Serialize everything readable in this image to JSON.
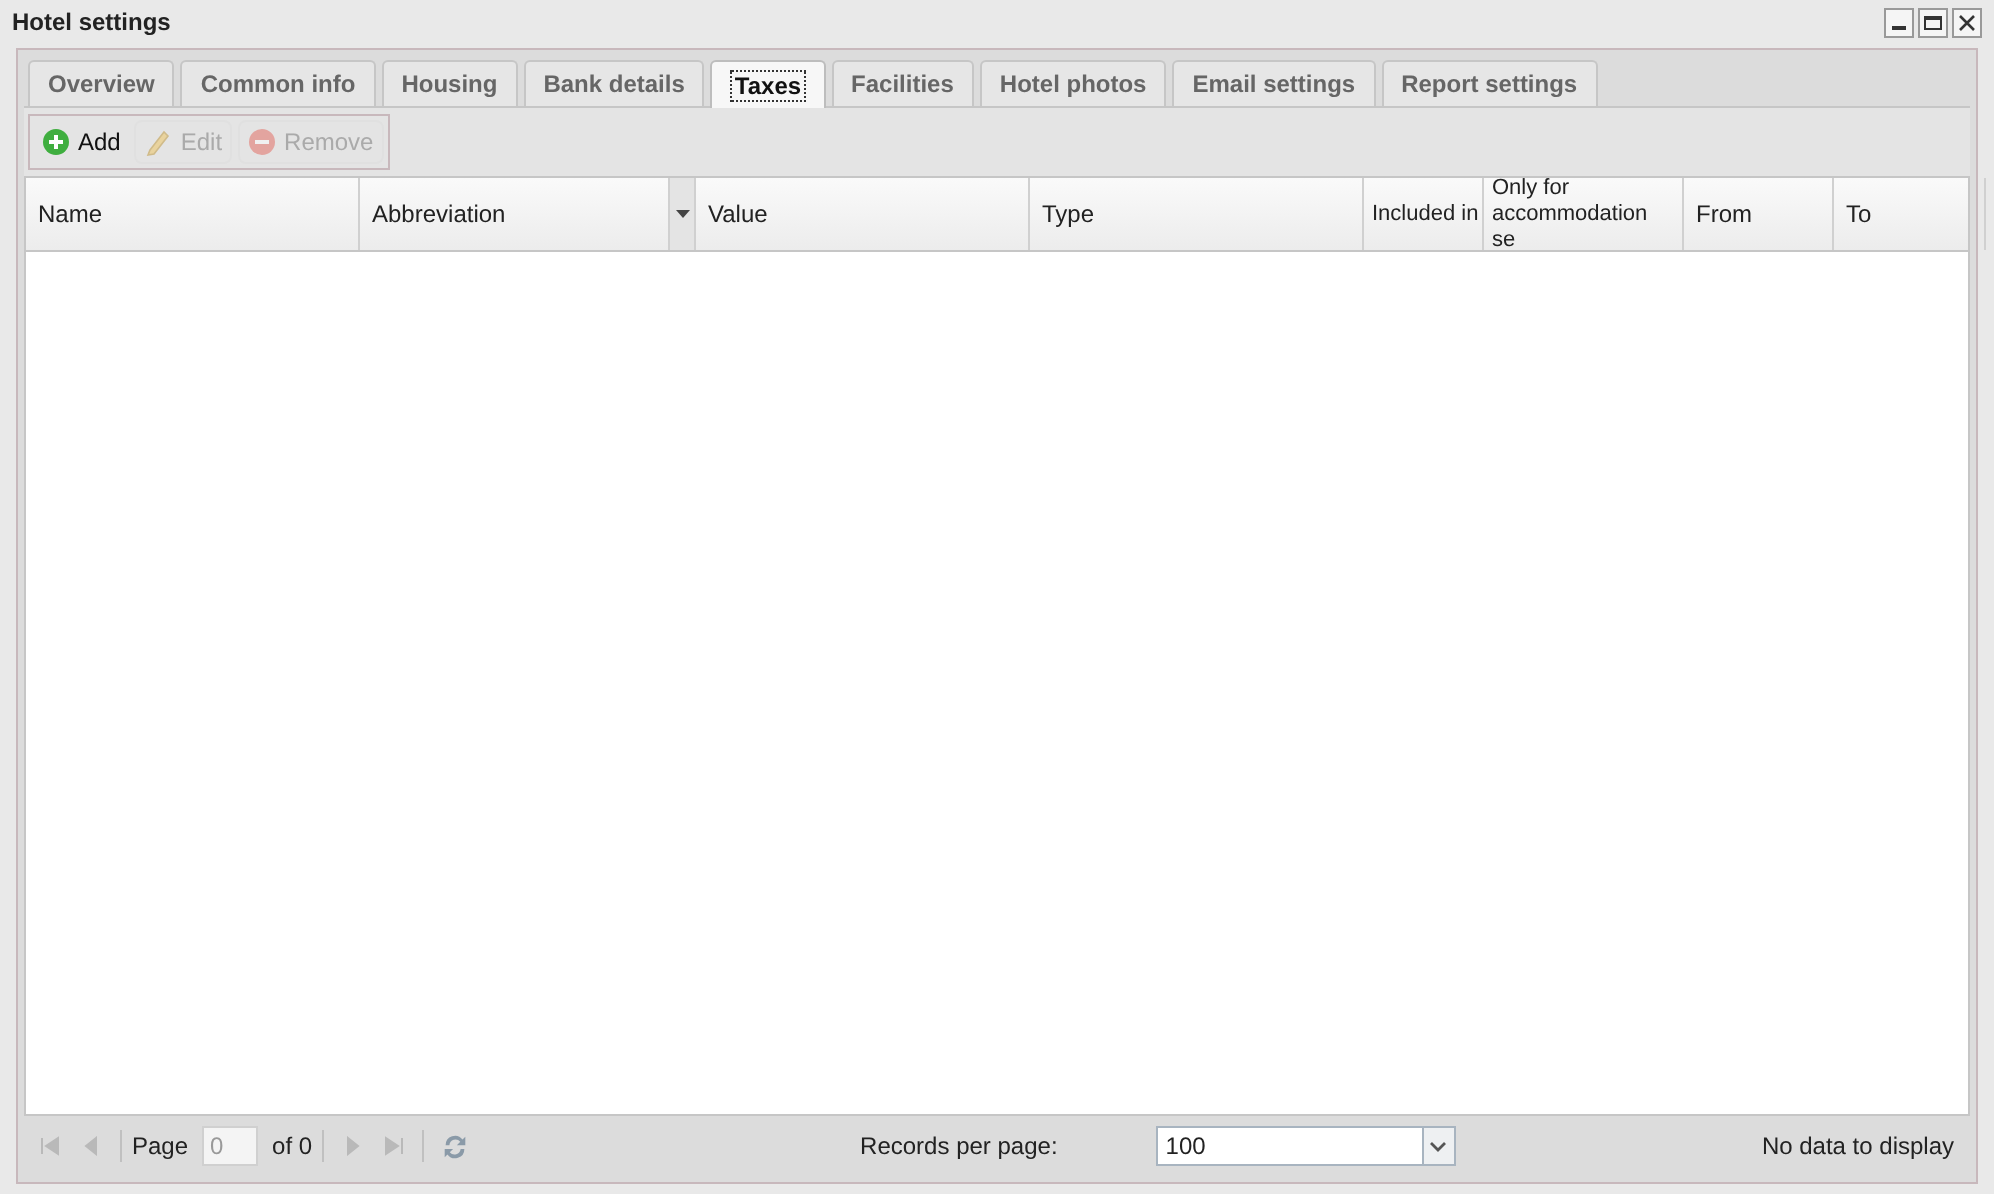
{
  "window": {
    "title": "Hotel settings"
  },
  "tabs": [
    {
      "label": "Overview",
      "selected": false
    },
    {
      "label": "Common info",
      "selected": false
    },
    {
      "label": "Housing",
      "selected": false
    },
    {
      "label": "Bank details",
      "selected": false
    },
    {
      "label": "Taxes",
      "selected": true
    },
    {
      "label": "Facilities",
      "selected": false
    },
    {
      "label": "Hotel photos",
      "selected": false
    },
    {
      "label": "Email settings",
      "selected": false
    },
    {
      "label": "Report settings",
      "selected": false
    }
  ],
  "toolbar": [
    {
      "kind": "add",
      "label": "Add",
      "disabled": false
    },
    {
      "kind": "edit",
      "label": "Edit",
      "disabled": true
    },
    {
      "kind": "remove",
      "label": "Remove",
      "disabled": true
    }
  ],
  "table": {
    "columns": [
      {
        "label": "Name",
        "menu": false
      },
      {
        "label": "Abbreviation",
        "menu": true
      },
      {
        "label": "Value",
        "menu": false
      },
      {
        "label": "Type",
        "menu": false
      },
      {
        "label": "Included in",
        "menu": false
      },
      {
        "label": "Only for accommodation se",
        "menu": false
      },
      {
        "label": "From",
        "menu": false
      },
      {
        "label": "To",
        "menu": false
      }
    ]
  },
  "pager": {
    "page_label": "Page",
    "page": "0",
    "of": "of 0",
    "records_label": "Records per page:",
    "records": "100",
    "status": "No data to display"
  }
}
